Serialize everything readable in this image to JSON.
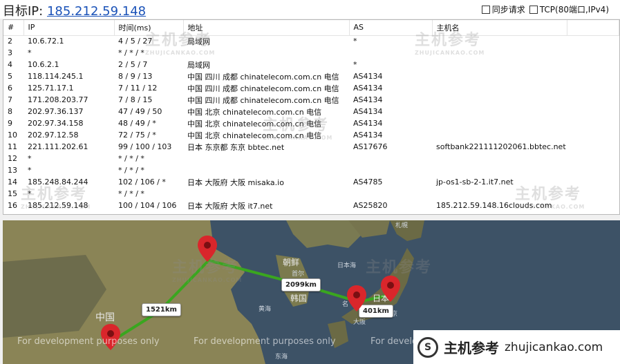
{
  "header": {
    "target_label": "目标IP:",
    "target_ip": "185.212.59.148",
    "sync_label": "同步请求",
    "tcp_label": "TCP(80端口,IPv4)"
  },
  "columns": [
    "#",
    "IP",
    "时间(ms)",
    "地址",
    "AS",
    "主机名"
  ],
  "hops": [
    {
      "n": "2",
      "ip": "10.6.72.1",
      "time": "4 / 5 / 27",
      "addr": "局域网",
      "as": "*",
      "host": ""
    },
    {
      "n": "3",
      "ip": "*",
      "time": "* / * / *",
      "addr": "",
      "as": "",
      "host": ""
    },
    {
      "n": "4",
      "ip": "10.6.2.1",
      "time": "2 / 5 / 7",
      "addr": "局域网",
      "as": "*",
      "host": ""
    },
    {
      "n": "5",
      "ip": "118.114.245.1",
      "time": "8 / 9 / 13",
      "addr": "中国 四川 成都 chinatelecom.com.cn 电信",
      "as": "AS4134",
      "host": ""
    },
    {
      "n": "6",
      "ip": "125.71.17.1",
      "time": "7 / 11 / 12",
      "addr": "中国 四川 成都 chinatelecom.com.cn 电信",
      "as": "AS4134",
      "host": ""
    },
    {
      "n": "7",
      "ip": "171.208.203.77",
      "time": "7 / 8 / 15",
      "addr": "中国 四川 成都 chinatelecom.com.cn 电信",
      "as": "AS4134",
      "host": ""
    },
    {
      "n": "8",
      "ip": "202.97.36.137",
      "time": "47 / 49 / 50",
      "addr": "中国 北京 chinatelecom.com.cn 电信",
      "as": "AS4134",
      "host": ""
    },
    {
      "n": "9",
      "ip": "202.97.34.158",
      "time": "48 / 49 / *",
      "addr": "中国 北京 chinatelecom.com.cn 电信",
      "as": "AS4134",
      "host": ""
    },
    {
      "n": "10",
      "ip": "202.97.12.58",
      "time": "72 / 75 / *",
      "addr": "中国 北京 chinatelecom.com.cn 电信",
      "as": "AS4134",
      "host": ""
    },
    {
      "n": "11",
      "ip": "221.111.202.61",
      "time": "99 / 100 / 103",
      "addr": "日本 东京都 东京 bbtec.net",
      "as": "AS17676",
      "host": "softbank221111202061.bbtec.net"
    },
    {
      "n": "12",
      "ip": "*",
      "time": "* / * / *",
      "addr": "",
      "as": "",
      "host": ""
    },
    {
      "n": "13",
      "ip": "*",
      "time": "* / * / *",
      "addr": "",
      "as": "",
      "host": ""
    },
    {
      "n": "14",
      "ip": "185.248.84.244",
      "time": "102 / 106 / *",
      "addr": "日本 大阪府 大阪 misaka.io",
      "as": "AS4785",
      "host": "jp-os1-sb-2-1.it7.net"
    },
    {
      "n": "15",
      "ip": "*",
      "time": "* / * / *",
      "addr": "",
      "as": "",
      "host": ""
    },
    {
      "n": "16",
      "ip": "185.212.59.148",
      "time": "100 / 104 / 106",
      "addr": "日本 大阪府 大阪 it7.net",
      "as": "AS25820",
      "host": "185.212.59.148.16clouds.com"
    }
  ],
  "map": {
    "distances": [
      "1521km",
      "2099km",
      "401km"
    ],
    "labels": {
      "china": "中国",
      "korea_n": "朝鲜",
      "seoul": "首尔",
      "korea": "韩国",
      "sea_japan": "日本海",
      "yellow_sea": "黄海",
      "east_sea": "东海",
      "sapporo": "札幌",
      "osaka": "大阪",
      "tokyo": "京",
      "japan": "日本",
      "nagoya": "名"
    },
    "dev_note": "For development purposes only",
    "colors": {
      "route": "#3aa61f",
      "pin": "#d9262b",
      "sea": "#3d5266"
    }
  },
  "watermark": {
    "cn": "主机参考",
    "en": "ZHUJICANKAO.COM"
  },
  "brand": {
    "name": "主机参考",
    "url": "zhujicankao.com",
    "logo": "S"
  }
}
